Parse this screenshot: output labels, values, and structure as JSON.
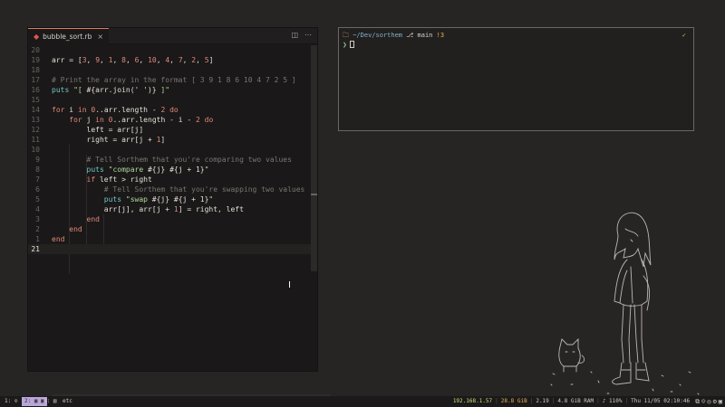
{
  "editor": {
    "tab_filename": "bubble_sort.rb",
    "tab_close": "×",
    "split_icon": "◫",
    "more_icon": "⋯",
    "lines": [
      {
        "n": "20",
        "html": ""
      },
      {
        "n": "19",
        "html": "arr = [<span class=\"num\">3</span>, <span class=\"num\">9</span>, <span class=\"num\">1</span>, <span class=\"num\">8</span>, <span class=\"num\">6</span>, <span class=\"num\">10</span>, <span class=\"num\">4</span>, <span class=\"num\">7</span>, <span class=\"num\">2</span>, <span class=\"num\">5</span>]"
      },
      {
        "n": "18",
        "html": ""
      },
      {
        "n": "17",
        "html": "<span class=\"cm\"># Print the array in the format [ 3 9 1 8 6 10 4 7 2 5 ]</span>"
      },
      {
        "n": "16",
        "html": "<span class=\"fn\">puts</span> <span class=\"str\">\"[ </span><span class=\"intp\">#{arr.join(' ')}</span><span class=\"str\"> ]\"</span>"
      },
      {
        "n": "15",
        "html": ""
      },
      {
        "n": "14",
        "html": "<span class=\"kw\">for</span> i <span class=\"kw\">in</span> <span class=\"num\">0</span>..arr.length - <span class=\"num\">2</span> <span class=\"kw\">do</span>"
      },
      {
        "n": "13",
        "html": "    <span class=\"kw\">for</span> j <span class=\"kw\">in</span> <span class=\"num\">0</span>..arr.length - i - <span class=\"num\">2</span> <span class=\"kw\">do</span>"
      },
      {
        "n": "12",
        "html": "        left = arr[j]"
      },
      {
        "n": "11",
        "html": "        right = arr[j + <span class=\"num\">1</span>]"
      },
      {
        "n": "10",
        "html": ""
      },
      {
        "n": "9",
        "html": "        <span class=\"cm\"># Tell Sorthem that you're comparing two values</span>"
      },
      {
        "n": "8",
        "html": "        <span class=\"fn\">puts</span> <span class=\"str\">\"compare </span><span class=\"intp\">#{j}</span><span class=\"str\"> </span><span class=\"intp\">#{j + 1}</span><span class=\"str\">\"</span>"
      },
      {
        "n": "7",
        "html": "        <span class=\"kw\">if</span> left &gt; right"
      },
      {
        "n": "6",
        "html": "            <span class=\"cm\"># Tell Sorthem that you're swapping two values</span>"
      },
      {
        "n": "5",
        "html": "            <span class=\"fn\">puts</span> <span class=\"str\">\"swap </span><span class=\"intp\">#{j}</span><span class=\"str\"> </span><span class=\"intp\">#{j + 1}</span><span class=\"str\">\"</span>"
      },
      {
        "n": "4",
        "html": "            arr[j], arr[j + <span class=\"num\">1</span>] = right, left"
      },
      {
        "n": "3",
        "html": "        <span class=\"kw\">end</span>"
      },
      {
        "n": "2",
        "html": "    <span class=\"kw\">end</span>"
      },
      {
        "n": "1",
        "html": "<span class=\"kw\">end</span>"
      },
      {
        "n": "21",
        "html": "",
        "current": true
      }
    ],
    "cursor_icon": "I"
  },
  "terminal": {
    "folder_icon": "🗀",
    "path": "~/Dev/sorthem",
    "branch_icon": "⎇",
    "branch": "main",
    "status": "!3",
    "check": "✓",
    "prompt": "❯"
  },
  "statusbar": {
    "workspaces": [
      {
        "label": "1: ⊙",
        "active": false
      },
      {
        "label": "2: ▣ ▣",
        "active": true
      },
      {
        "label": "3: ▤",
        "active": false
      },
      {
        "label": "etc",
        "active": false
      }
    ],
    "ip": "192.168.1.57",
    "disk": "28.8 GiB",
    "load": "2.19",
    "ram": "4.8 GiB RAM",
    "volume": "♪ 110%",
    "date": "Thu 11/05 02:10:46",
    "tray_icons": [
      "⧉",
      "☺",
      "◎",
      "⚙",
      "▣"
    ]
  }
}
